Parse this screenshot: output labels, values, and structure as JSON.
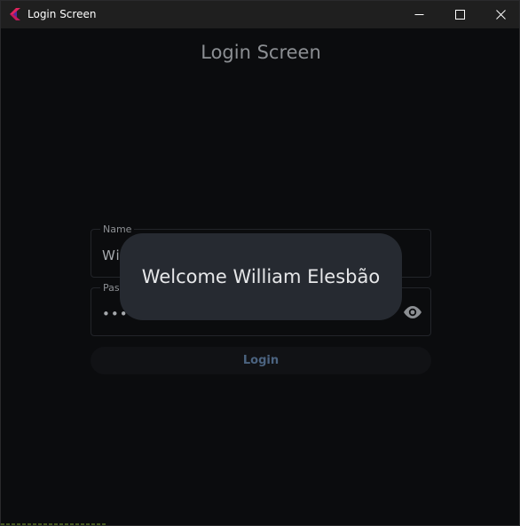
{
  "window": {
    "title": "Login Screen"
  },
  "page": {
    "title": "Login Screen"
  },
  "form": {
    "name_label": "Name",
    "name_value": "Wi",
    "password_label": "Pass",
    "password_value": "••••",
    "login_label": "Login"
  },
  "toast": {
    "message": "Welcome William Elesbão"
  },
  "icons": {
    "app": "flutter-app-icon",
    "minimize": "minimize-icon",
    "maximize": "maximize-icon",
    "close": "close-icon",
    "visibility": "eye-icon"
  },
  "colors": {
    "background": "#0b0c0e",
    "titlebar": "#1f1f1f",
    "toast": "#262a31",
    "login_text": "#4b6380"
  }
}
